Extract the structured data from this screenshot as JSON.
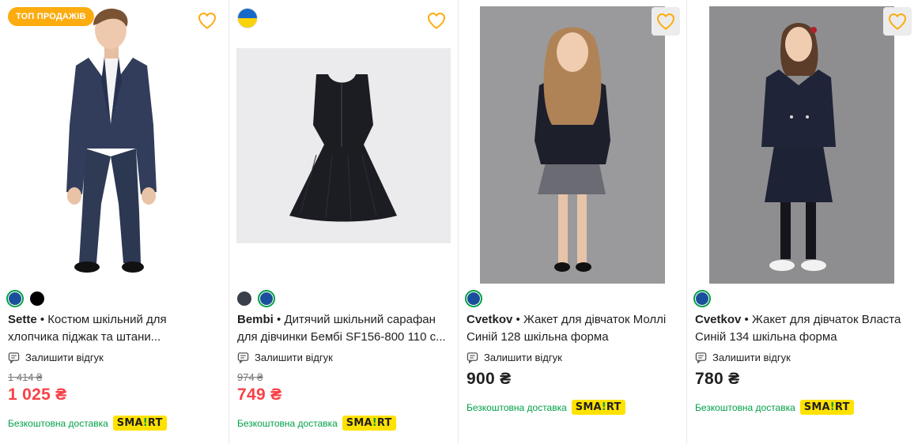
{
  "labels": {
    "leave_review": "Залишити відгук",
    "free_delivery": "Безкоштовна доставка",
    "smart": {
      "pre": "SMA",
      "mark": "!",
      "post": "RT"
    }
  },
  "colors": {
    "price_red": "#f84147",
    "green": "#00a046",
    "badge_orange": "#fcac0f",
    "heart_orange": "#fcac0f"
  },
  "products": [
    {
      "badge": "ТОП ПРОДАЖІВ",
      "brand": "Sette",
      "name": "Костюм шкільний для хлопчика піджак та штани...",
      "old_price": "1 414 ₴",
      "price": "1 025 ₴",
      "swatches": [
        "#1a4f9c",
        "#000000"
      ]
    },
    {
      "brand": "Bembi",
      "name": "Дитячий шкільний сарафан для дівчинки Бембі SF156-800 110 с...",
      "old_price": "974 ₴",
      "price": "749 ₴",
      "swatches": [
        "#3b3f4a",
        "#1a4f9c"
      ]
    },
    {
      "brand": "Cvetkov",
      "name": "Жакет для дівчаток Моллі Синій 128 шкільна форма",
      "price": "900 ₴",
      "swatches": [
        "#1a4f9c"
      ]
    },
    {
      "brand": "Cvetkov",
      "name": "Жакет для дівчаток Власта Синій 134 шкільна форма",
      "price": "780 ₴",
      "swatches": [
        "#1a4f9c"
      ]
    }
  ]
}
